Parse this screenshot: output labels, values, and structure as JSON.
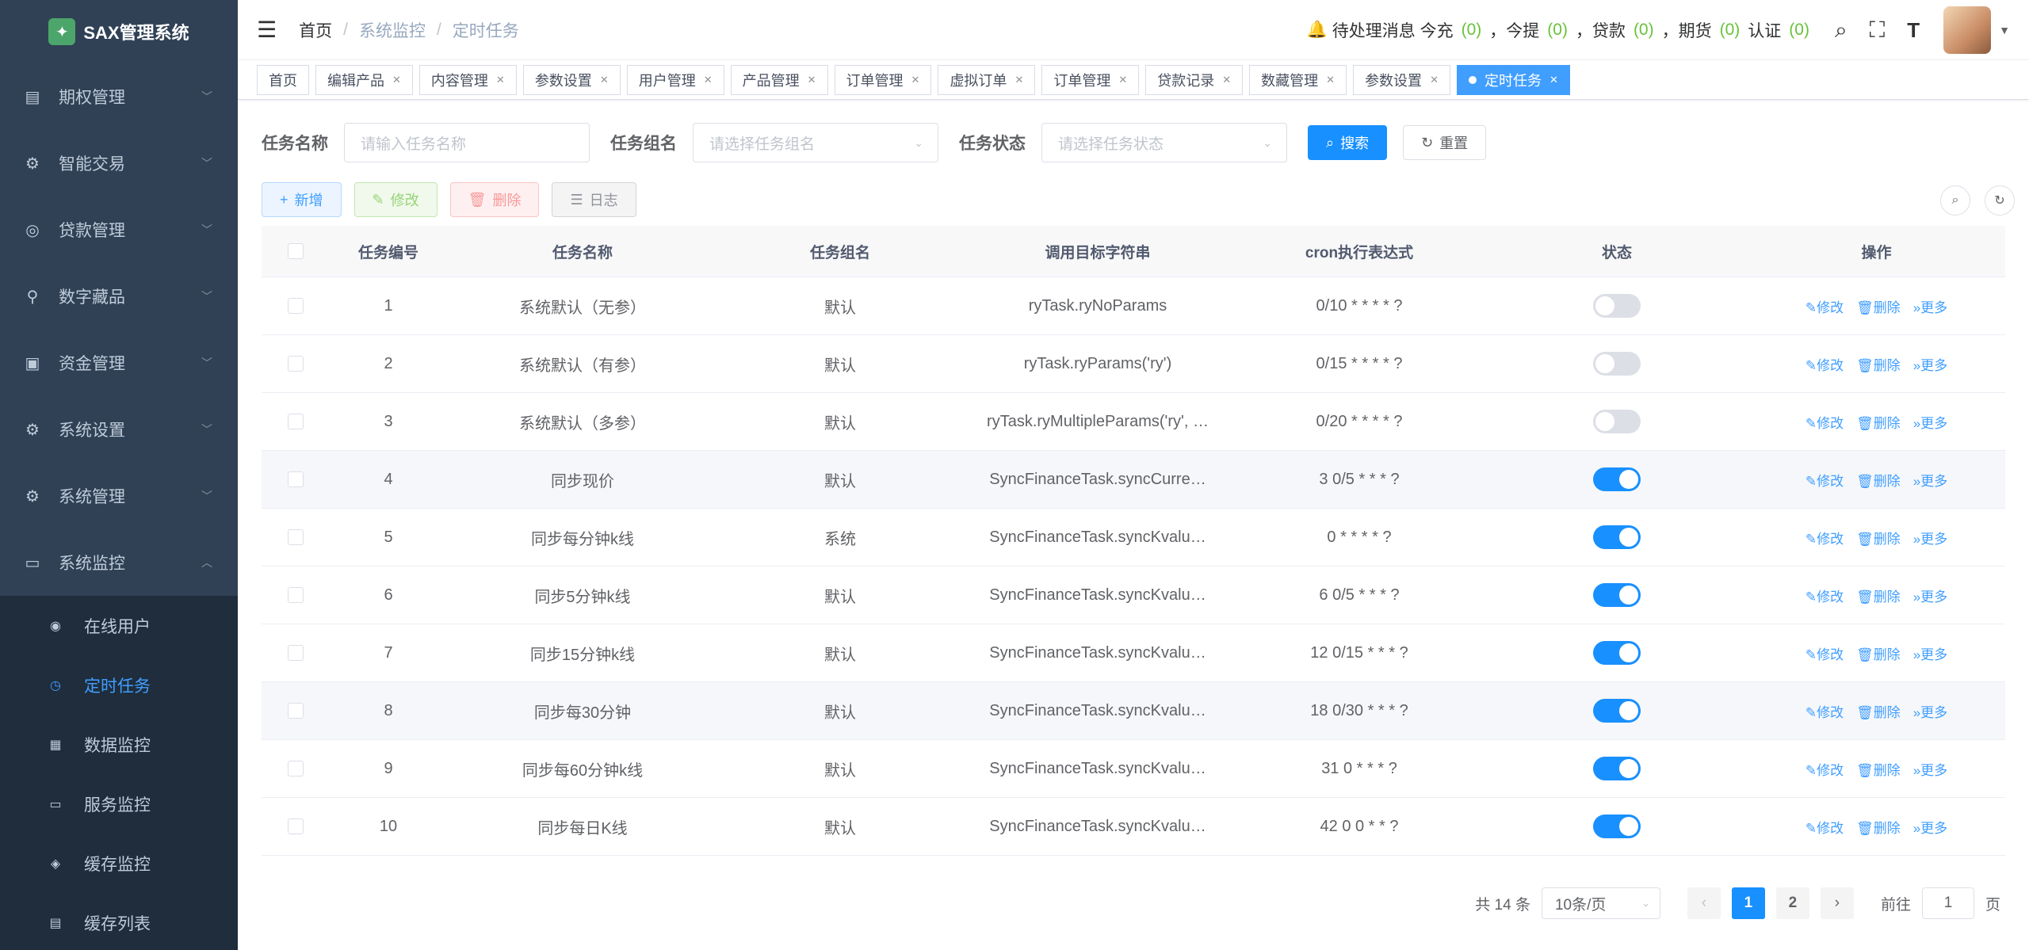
{
  "app": {
    "title": "SAX管理系统"
  },
  "sidebar": {
    "menus": [
      {
        "label": "期权管理",
        "icon": "chart-icon"
      },
      {
        "label": "智能交易",
        "icon": "gear-icon"
      },
      {
        "label": "贷款管理",
        "icon": "coins-icon"
      },
      {
        "label": "数字藏品",
        "icon": "nodes-icon"
      },
      {
        "label": "资金管理",
        "icon": "wallet-icon"
      },
      {
        "label": "系统设置",
        "icon": "gear-icon"
      },
      {
        "label": "系统管理",
        "icon": "gear-icon"
      },
      {
        "label": "系统监控",
        "icon": "monitor-icon"
      }
    ],
    "submenus": [
      {
        "label": "在线用户"
      },
      {
        "label": "定时任务"
      },
      {
        "label": "数据监控"
      },
      {
        "label": "服务监控"
      },
      {
        "label": "缓存监控"
      },
      {
        "label": "缓存列表"
      }
    ]
  },
  "header": {
    "breadcrumb": {
      "home": "首页",
      "mid": "系统监控",
      "current": "定时任务"
    },
    "notice_label": "待处理消息 今充",
    "notice_items": [
      {
        "count": "(0)",
        "label": "，今提"
      },
      {
        "count": "(0)",
        "label": "，贷款"
      },
      {
        "count": "(0)",
        "label": "，期货"
      },
      {
        "count": "(0)",
        "label": "认证"
      },
      {
        "count": "(0)",
        "label": ""
      }
    ]
  },
  "tags": [
    {
      "label": "首页",
      "closable": false
    },
    {
      "label": "编辑产品"
    },
    {
      "label": "内容管理"
    },
    {
      "label": "参数设置"
    },
    {
      "label": "用户管理"
    },
    {
      "label": "产品管理"
    },
    {
      "label": "订单管理"
    },
    {
      "label": "虚拟订单"
    },
    {
      "label": "订单管理"
    },
    {
      "label": "贷款记录"
    },
    {
      "label": "数藏管理"
    },
    {
      "label": "参数设置"
    },
    {
      "label": "定时任务",
      "active": true
    }
  ],
  "search": {
    "name_label": "任务名称",
    "name_placeholder": "请输入任务名称",
    "group_label": "任务组名",
    "group_placeholder": "请选择任务组名",
    "status_label": "任务状态",
    "status_placeholder": "请选择任务状态",
    "search_btn": "搜索",
    "reset_btn": "重置"
  },
  "toolbar": {
    "add": "新增",
    "edit": "修改",
    "delete": "删除",
    "log": "日志"
  },
  "table": {
    "headers": {
      "id": "任务编号",
      "name": "任务名称",
      "group": "任务组名",
      "target": "调用目标字符串",
      "cron": "cron执行表达式",
      "status": "状态",
      "ops": "操作"
    },
    "ops": {
      "edit": "修改",
      "delete": "删除",
      "more": "更多"
    },
    "rows": [
      {
        "id": "1",
        "name": "系统默认（无参）",
        "group": "默认",
        "target": "ryTask.ryNoParams",
        "cron": "0/10 * * * * ?",
        "status": false
      },
      {
        "id": "2",
        "name": "系统默认（有参）",
        "group": "默认",
        "target": "ryTask.ryParams('ry')",
        "cron": "0/15 * * * * ?",
        "status": false
      },
      {
        "id": "3",
        "name": "系统默认（多参）",
        "group": "默认",
        "target": "ryTask.ryMultipleParams('ry', …",
        "cron": "0/20 * * * * ?",
        "status": false
      },
      {
        "id": "4",
        "name": "同步现价",
        "group": "默认",
        "target": "SyncFinanceTask.syncCurre…",
        "cron": "3 0/5 * * * ?",
        "status": true
      },
      {
        "id": "5",
        "name": "同步每分钟k线",
        "group": "系统",
        "target": "SyncFinanceTask.syncKvalu…",
        "cron": "0 * * * * ?",
        "status": true
      },
      {
        "id": "6",
        "name": "同步5分钟k线",
        "group": "默认",
        "target": "SyncFinanceTask.syncKvalu…",
        "cron": "6 0/5 * * * ?",
        "status": true
      },
      {
        "id": "7",
        "name": "同步15分钟k线",
        "group": "默认",
        "target": "SyncFinanceTask.syncKvalu…",
        "cron": "12 0/15 * * * ?",
        "status": true
      },
      {
        "id": "8",
        "name": "同步每30分钟",
        "group": "默认",
        "target": "SyncFinanceTask.syncKvalu…",
        "cron": "18 0/30 * * * ?",
        "status": true
      },
      {
        "id": "9",
        "name": "同步每60分钟k线",
        "group": "默认",
        "target": "SyncFinanceTask.syncKvalu…",
        "cron": "31 0 * * * ?",
        "status": true
      },
      {
        "id": "10",
        "name": "同步每日K线",
        "group": "默认",
        "target": "SyncFinanceTask.syncKvalu…",
        "cron": "42 0 0 * * ?",
        "status": true
      }
    ]
  },
  "pagination": {
    "total": "共 14 条",
    "page_size": "10条/页",
    "pages": [
      "1",
      "2"
    ],
    "current": "1",
    "goto_label": "前往",
    "goto_value": "1",
    "page_suffix": "页"
  },
  "colors": {
    "sidebar_bg": "#304156",
    "primary": "#1890ff",
    "success": "#67c23a"
  }
}
